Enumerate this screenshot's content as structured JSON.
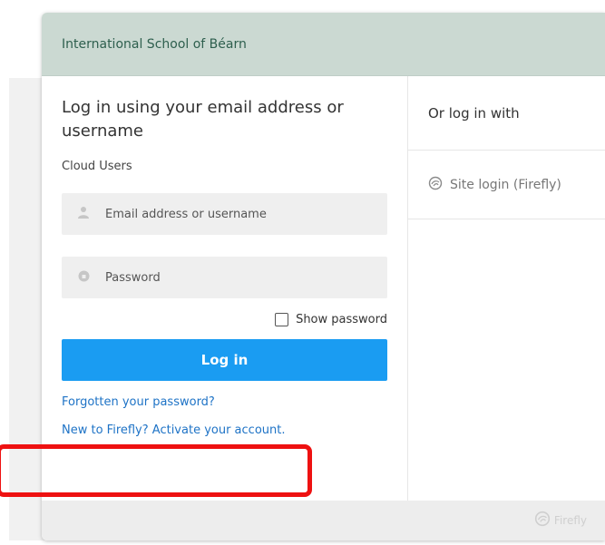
{
  "header": {
    "school_name": "International School of Béarn"
  },
  "login": {
    "title": "Log in using your email address or username",
    "subhead": "Cloud Users",
    "email_placeholder": "Email address or username",
    "password_placeholder": "Password",
    "show_password_label": "Show password",
    "login_button": "Log in",
    "forgot_link": "Forgotten your password?",
    "activate_link": "New to Firefly? Activate your account."
  },
  "alternate": {
    "title": "Or log in with",
    "site_login": "Site login (Firefly)"
  },
  "footer": {
    "brand": "Firefly"
  },
  "icons": {
    "user": "user-icon",
    "lock": "lock-icon",
    "firefly": "firefly-logo-icon"
  },
  "colors": {
    "header_bg": "#cbd9d2",
    "header_text": "#2e5f4e",
    "primary": "#1a9cf2",
    "link": "#1e73c6",
    "highlight": "#ee1111"
  }
}
